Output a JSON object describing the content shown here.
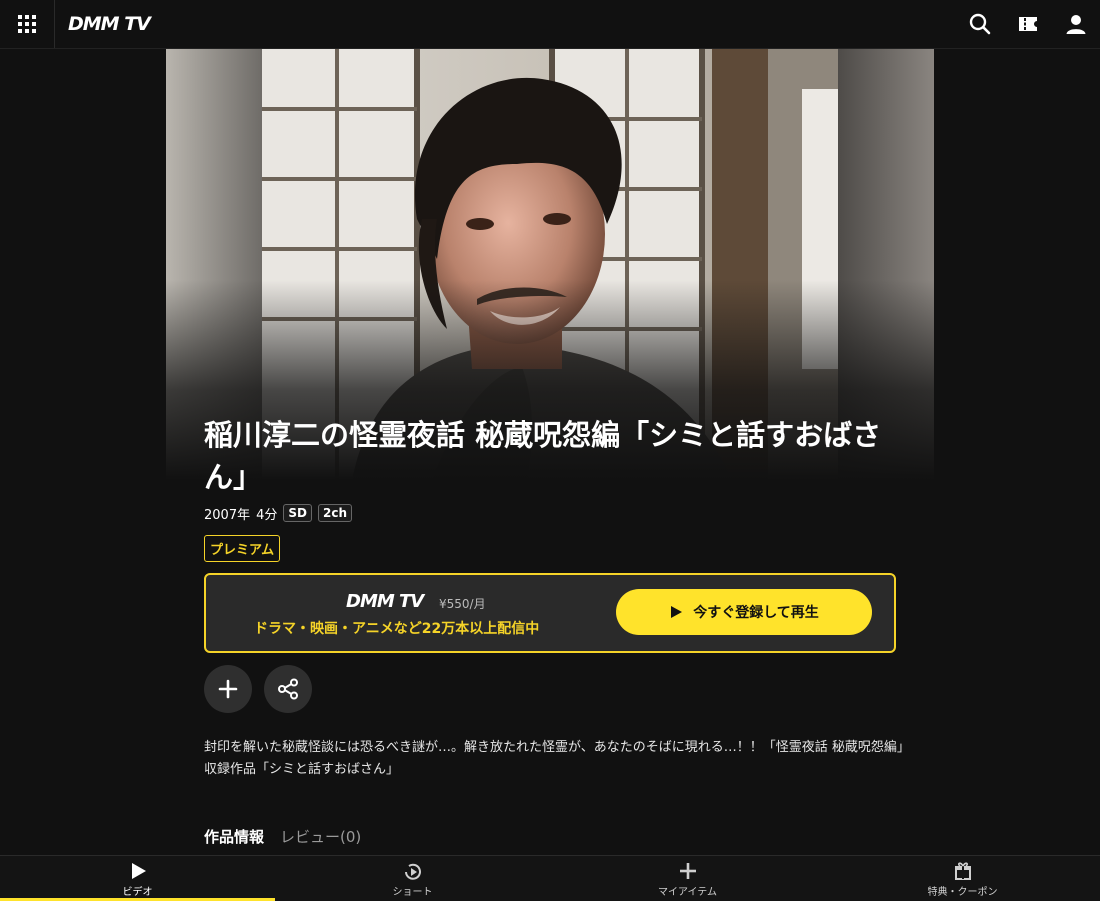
{
  "header": {
    "logo": "DMM TV",
    "icons": [
      "grid-menu-icon",
      "search-icon",
      "ticket-icon",
      "user-icon"
    ]
  },
  "hero": {
    "image": "person-portrait"
  },
  "title": "稲川淳二の怪霊夜話 秘蔵呪怨編「シミと話すおばさん」",
  "meta": {
    "year": "2007年",
    "duration": "4分",
    "quality": "SD",
    "audio": "2ch"
  },
  "premium_badge": "プレミアム",
  "subscribe": {
    "logo": "DMM TV",
    "price": "¥550/月",
    "copy": "ドラマ・映画・アニメなど22万本以上配信中",
    "button": "今すぐ登録して再生"
  },
  "actions": [
    "add-icon",
    "share-icon"
  ],
  "description": "封印を解いた秘蔵怪談には恐るべき謎が…。解き放たれた怪霊が、あなたのそばに現れる…！！「怪霊夜話 秘蔵呪怨編」収録作品「シミと話すおばさん」",
  "tabs": {
    "info": "作品情報",
    "review": "レビュー(0)"
  },
  "bottom_nav": [
    {
      "label": "ビデオ",
      "icon": "play-icon",
      "active": true
    },
    {
      "label": "ショート",
      "icon": "short-play-icon",
      "active": false
    },
    {
      "label": "マイアイテム",
      "icon": "plus-icon",
      "active": false
    },
    {
      "label": "特典・クーポン",
      "icon": "gift-icon",
      "active": false
    }
  ],
  "colors": {
    "background": "#111111",
    "accent": "#ffe32b",
    "premium": "#f5d328"
  }
}
